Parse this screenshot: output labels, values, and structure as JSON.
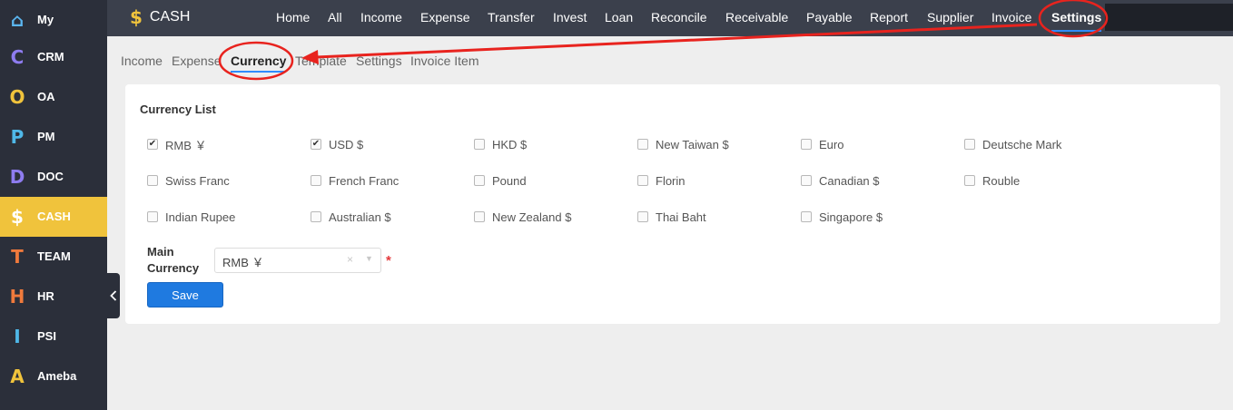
{
  "sidebar": {
    "items": [
      {
        "icon": "home-icon",
        "glyph": "⌂",
        "color": "#5bb6f0",
        "label": "My"
      },
      {
        "icon": "crm-letter-icon",
        "glyph": "C",
        "color": "#8e7cf0",
        "label": "CRM"
      },
      {
        "icon": "oa-ring-icon",
        "glyph": "O",
        "color": "#f0c33c",
        "label": "OA"
      },
      {
        "icon": "pm-letter-icon",
        "glyph": "P",
        "color": "#4fb8e8",
        "label": "PM"
      },
      {
        "icon": "doc-letter-icon",
        "glyph": "D",
        "color": "#8e7cf0",
        "label": "DOC"
      },
      {
        "icon": "dollar-icon",
        "glyph": "$",
        "color": "#ffffff",
        "label": "CASH"
      },
      {
        "icon": "team-letter-icon",
        "glyph": "T",
        "color": "#f07a3c",
        "label": "TEAM"
      },
      {
        "icon": "hr-letter-icon",
        "glyph": "H",
        "color": "#f07a3c",
        "label": "HR"
      },
      {
        "icon": "psi-letter-icon",
        "glyph": "I",
        "color": "#4fb8e8",
        "label": "PSI"
      },
      {
        "icon": "ameba-letter-icon",
        "glyph": "A",
        "color": "#f0c33c",
        "label": "Ameba"
      }
    ],
    "active_index": 5,
    "collapse_icon": "chevron-left-icon"
  },
  "topbar": {
    "brand_icon": "$",
    "brand_name": "CASH",
    "nav": [
      "Home",
      "All",
      "Income",
      "Expense",
      "Transfer",
      "Invest",
      "Loan",
      "Reconcile",
      "Receivable",
      "Payable",
      "Report",
      "Supplier",
      "Invoice",
      "Settings"
    ],
    "active_nav": "Settings"
  },
  "subtabs": {
    "items": [
      "Income",
      "Expense",
      "Currency",
      "Template",
      "Settings",
      "Invoice Item"
    ],
    "active": "Currency"
  },
  "currency": {
    "title": "Currency List",
    "items": [
      {
        "label": "RMB ￥",
        "checked": true
      },
      {
        "label": "USD $",
        "checked": true
      },
      {
        "label": "HKD $",
        "checked": false
      },
      {
        "label": "New Taiwan $",
        "checked": false
      },
      {
        "label": "Euro",
        "checked": false
      },
      {
        "label": "Deutsche Mark",
        "checked": false
      },
      {
        "label": "Swiss Franc",
        "checked": false
      },
      {
        "label": "French Franc",
        "checked": false
      },
      {
        "label": "Pound",
        "checked": false
      },
      {
        "label": "Florin",
        "checked": false
      },
      {
        "label": "Canadian $",
        "checked": false
      },
      {
        "label": "Rouble",
        "checked": false
      },
      {
        "label": "Indian Rupee",
        "checked": false
      },
      {
        "label": "Australian $",
        "checked": false
      },
      {
        "label": "New Zealand $",
        "checked": false
      },
      {
        "label": "Thai Baht",
        "checked": false
      },
      {
        "label": "Singapore $",
        "checked": false
      }
    ],
    "main_label": "Main Currency",
    "main_value": "RMB ￥",
    "clear_glyph": "×",
    "caret_glyph": "▼",
    "required_mark": "*",
    "save_label": "Save"
  },
  "colors": {
    "accent_blue": "#1f7ae0",
    "cash_yellow": "#f0c33c",
    "annotation_red": "#e8231e"
  }
}
